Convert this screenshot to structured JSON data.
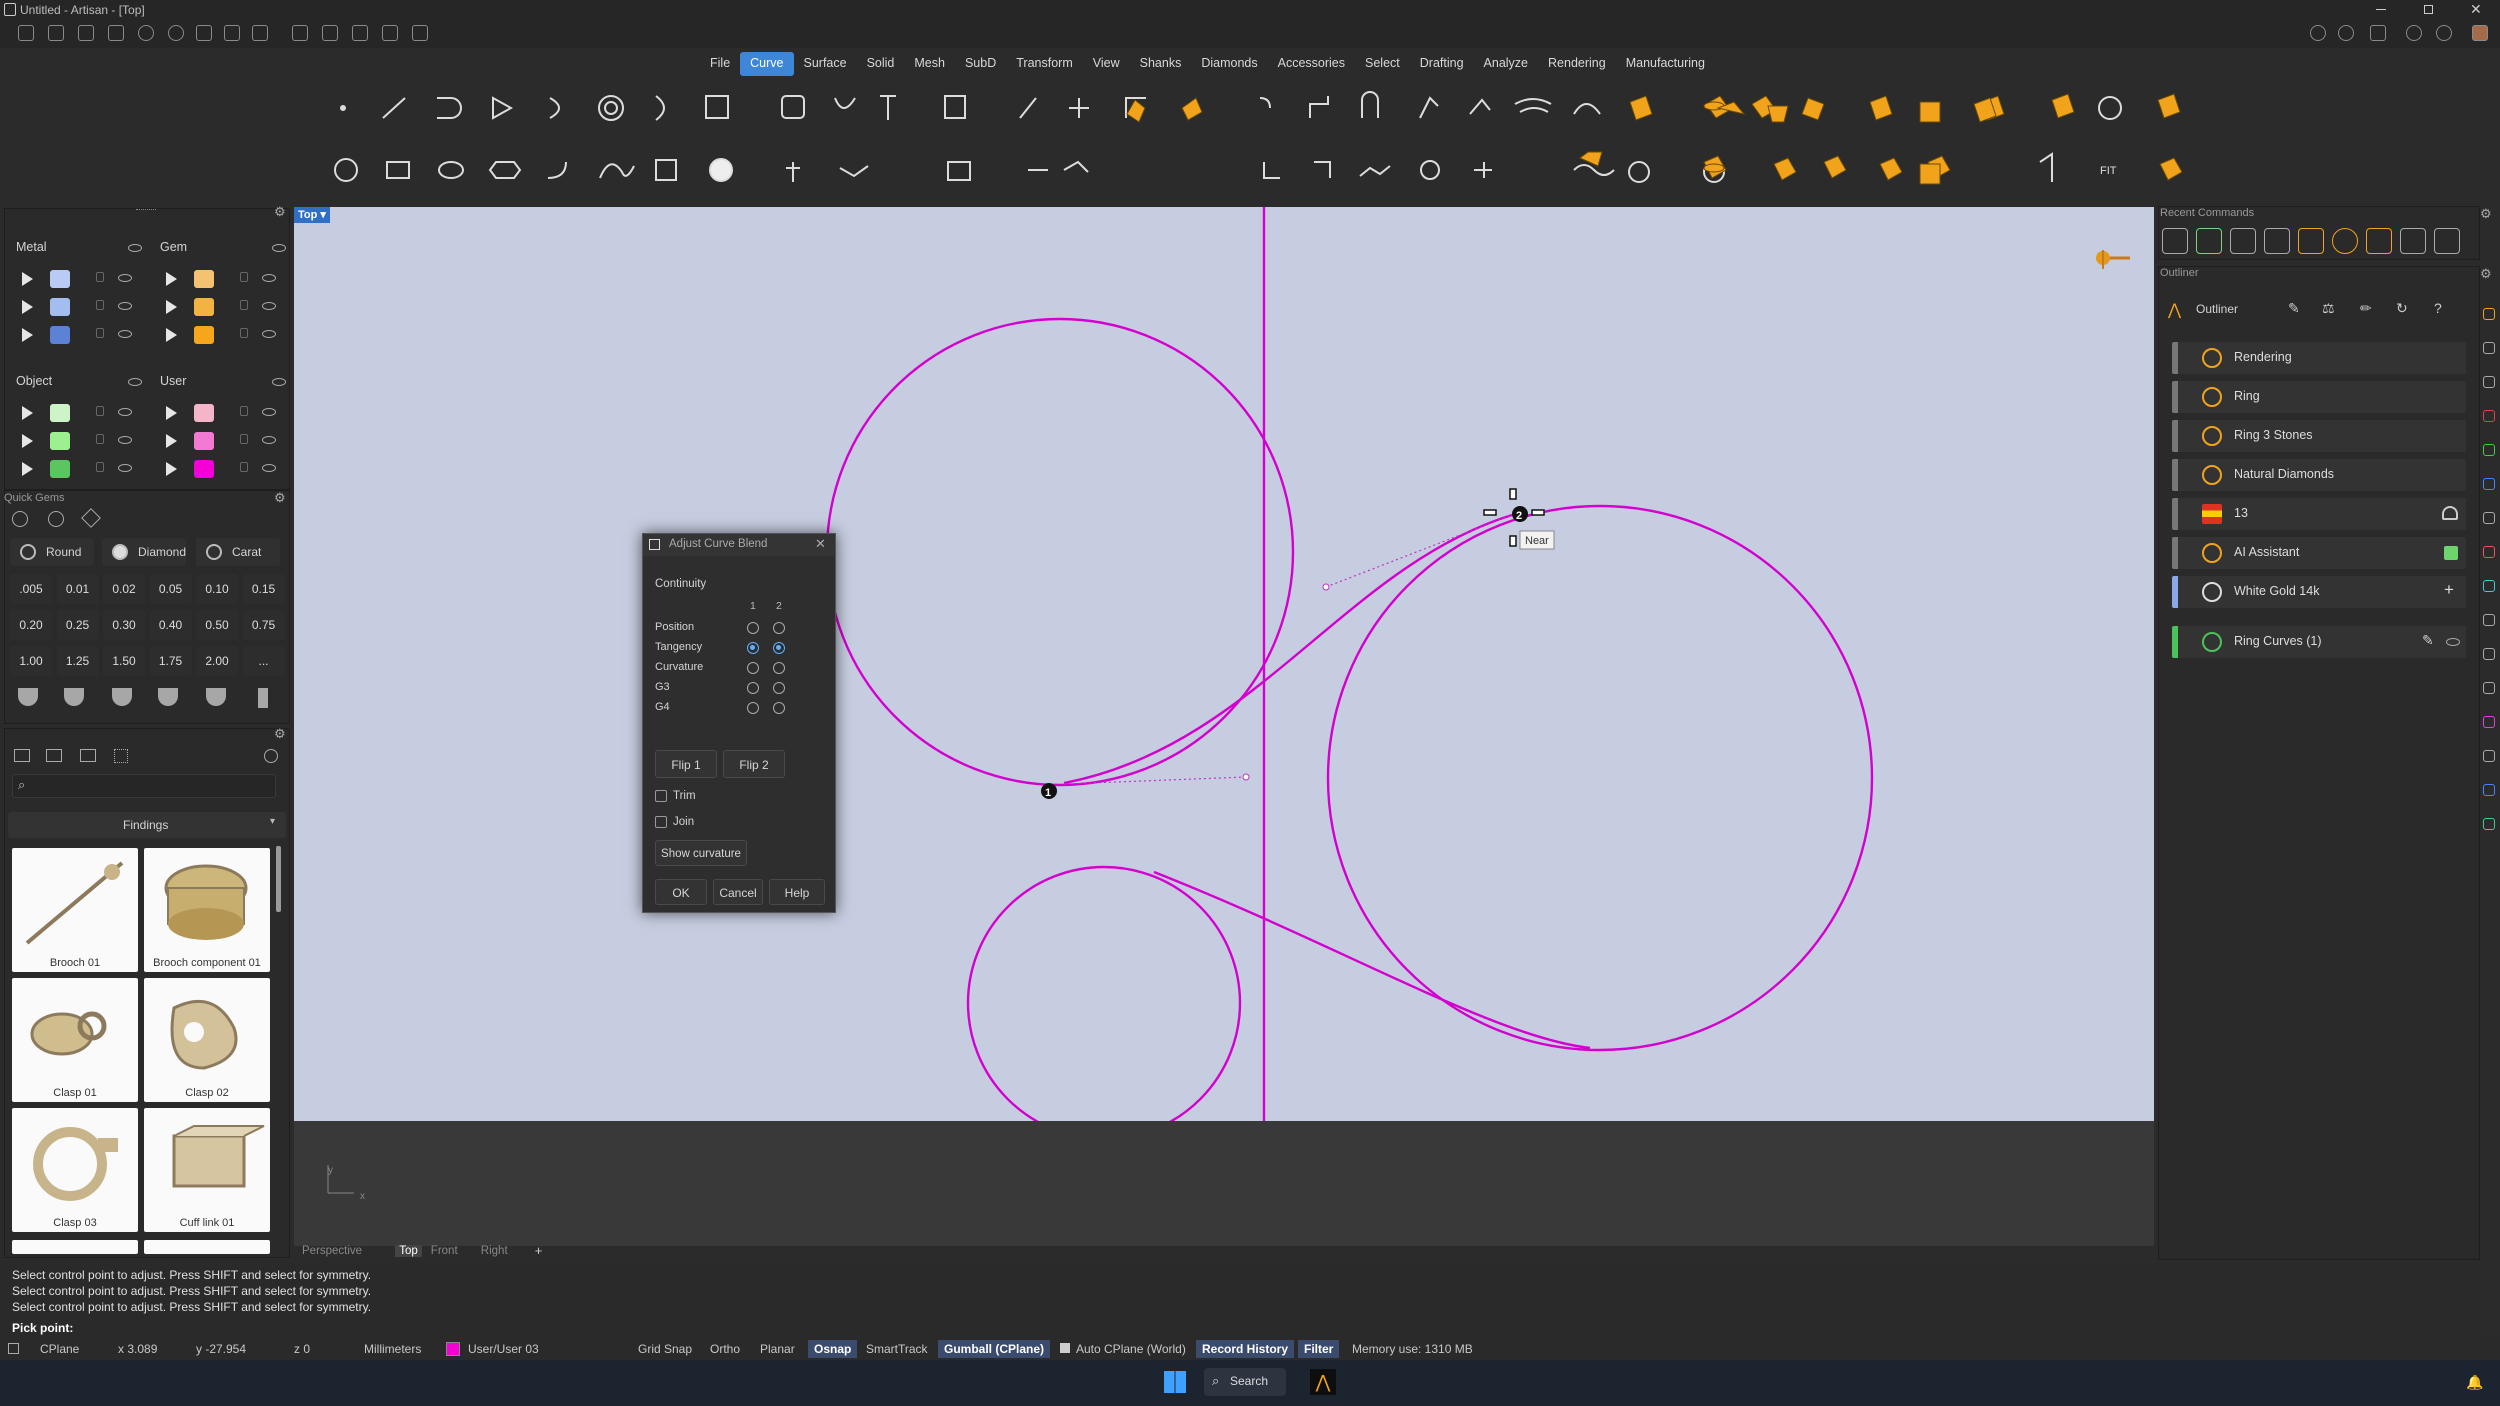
{
  "window": {
    "title": "Untitled - Artisan - [Top]"
  },
  "menu": [
    {
      "label": "File",
      "active": false
    },
    {
      "label": "Curve",
      "active": true
    },
    {
      "label": "Surface",
      "active": false
    },
    {
      "label": "Solid",
      "active": false
    },
    {
      "label": "Mesh",
      "active": false
    },
    {
      "label": "SubD",
      "active": false
    },
    {
      "label": "Transform",
      "active": false
    },
    {
      "label": "View",
      "active": false
    },
    {
      "label": "Shanks",
      "active": false
    },
    {
      "label": "Diamonds",
      "active": false
    },
    {
      "label": "Accessories",
      "active": false
    },
    {
      "label": "Select",
      "active": false
    },
    {
      "label": "Drafting",
      "active": false
    },
    {
      "label": "Analyze",
      "active": false
    },
    {
      "label": "Rendering",
      "active": false
    },
    {
      "label": "Manufacturing",
      "active": false
    }
  ],
  "layers": {
    "metal": {
      "title": "Metal",
      "colors": [
        "#b7cbf5",
        "#a4bdf0",
        "#5b82d4"
      ]
    },
    "gem": {
      "title": "Gem",
      "colors": [
        "#f5c271",
        "#f3b340",
        "#f5a61a"
      ]
    },
    "object": {
      "title": "Object",
      "colors": [
        "#cdf3c9",
        "#9cf090",
        "#5bc55f"
      ]
    },
    "user": {
      "title": "User",
      "colors": [
        "#f5b5c8",
        "#f27ad3",
        "#f400d6"
      ]
    }
  },
  "quick_gems": {
    "title": "Quick Gems",
    "shapes": [
      "Round",
      "Diamond",
      "Carat"
    ],
    "sizes": [
      ".005",
      "0.01",
      "0.02",
      "0.05",
      "0.10",
      "0.15",
      "0.20",
      "0.25",
      "0.30",
      "0.40",
      "0.50",
      "0.75",
      "1.00",
      "1.25",
      "1.50",
      "1.75",
      "2.00",
      "..."
    ]
  },
  "library": {
    "category": "Findings",
    "items": [
      "Brooch 01",
      "Brooch component 01",
      "Clasp 01",
      "Clasp 02",
      "Clasp 03",
      "Cuff link 01"
    ]
  },
  "viewport": {
    "name": "Top",
    "tabs": [
      "Perspective",
      "Top",
      "Front",
      "Right"
    ],
    "axis_x": "x",
    "axis_y": "y",
    "tooltip": "Near",
    "point1": "1",
    "point2": "2"
  },
  "dialog": {
    "title": "Adjust Curve Blend",
    "section": "Continuity",
    "col1": "1",
    "col2": "2",
    "rows": [
      {
        "label": "Position",
        "c1": false,
        "c2": false
      },
      {
        "label": "Tangency",
        "c1": true,
        "c2": true
      },
      {
        "label": "Curvature",
        "c1": false,
        "c2": false
      },
      {
        "label": "G3",
        "c1": false,
        "c2": false
      },
      {
        "label": "G4",
        "c1": false,
        "c2": false
      }
    ],
    "flip1": "Flip 1",
    "flip2": "Flip 2",
    "trim": "Trim",
    "join": "Join",
    "show_curvature": "Show curvature",
    "ok": "OK",
    "cancel": "Cancel",
    "help": "Help"
  },
  "right_panel": {
    "recent_title": "Recent Commands",
    "outliner_title": "Outliner",
    "outliner_label": "Outliner",
    "items": [
      {
        "label": "Rendering",
        "bar": "#777777"
      },
      {
        "label": "Ring",
        "bar": "#777777"
      },
      {
        "label": "Ring 3 Stones",
        "bar": "#777777"
      },
      {
        "label": "Natural Diamonds",
        "bar": "#777777"
      },
      {
        "label": "13",
        "bar": "#777777"
      },
      {
        "label": "AI Assistant",
        "bar": "#777777"
      },
      {
        "label": "White Gold 14k",
        "bar": "#8aa8e8"
      },
      {
        "label": "Ring Curves (1)",
        "bar": "#4cc25a"
      }
    ]
  },
  "command_log": [
    "Select control point to adjust. Press SHIFT and select for symmetry.",
    "Select control point to adjust. Press SHIFT and select for symmetry.",
    "Select control point to adjust. Press SHIFT and select for symmetry."
  ],
  "prompt": "Pick point:",
  "status": {
    "cplane": "CPlane",
    "x": "x 3.089",
    "y": "y -27.954",
    "z": "z 0",
    "units": "Millimeters",
    "layer": "User/User 03",
    "toggles": [
      "Grid Snap",
      "Ortho",
      "Planar",
      "Osnap",
      "SmartTrack",
      "Gumball (CPlane)",
      "Auto CPlane (World)",
      "Record History",
      "Filter"
    ],
    "memory": "Memory use: 1310 MB"
  },
  "taskbar": {
    "search": "Search"
  },
  "colors": {
    "curve": "#d400d0",
    "viewport": "#c6cde0",
    "accent": "#3e86d8"
  }
}
